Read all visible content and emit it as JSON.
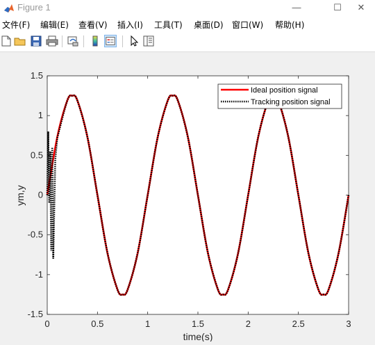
{
  "window": {
    "title": "Figure 1",
    "minimize_symbol": "—",
    "maximize_symbol": "☐",
    "close_symbol": "✕"
  },
  "menu": {
    "items": [
      {
        "label": "文件(F)"
      },
      {
        "label": "编辑(E)"
      },
      {
        "label": "查看(V)"
      },
      {
        "label": "插入(I)"
      },
      {
        "label": "工具(T)"
      },
      {
        "label": "桌面(D)"
      },
      {
        "label": "窗口(W)"
      },
      {
        "label": "帮助(H)"
      }
    ]
  },
  "toolbar": {
    "icons": [
      "new-figure-icon",
      "open-file-icon",
      "save-icon",
      "print-icon",
      "link-plot-icon",
      "insert-colorbar-icon",
      "insert-legend-icon",
      "edit-plot-pointer-icon",
      "property-inspector-icon"
    ]
  },
  "colors": {
    "ideal": "#ff0000",
    "tracking": "#000000",
    "accent": "#cfe4f7"
  },
  "chart_data": {
    "type": "line",
    "title": "",
    "xlabel": "time(s)",
    "ylabel": "ym,y",
    "xlim": [
      0,
      3
    ],
    "ylim": [
      -1.5,
      1.5
    ],
    "xticks": [
      0,
      0.5,
      1,
      1.5,
      2,
      2.5,
      3
    ],
    "xtick_labels": [
      "0",
      "0.5",
      "1",
      "1.5",
      "2",
      "2.5",
      "3"
    ],
    "yticks": [
      -1.5,
      -1,
      -0.5,
      0,
      0.5,
      1,
      1.5
    ],
    "ytick_labels": [
      "-1.5",
      "-1",
      "-0.5",
      "0",
      "0.5",
      "1",
      "1.5"
    ],
    "grid": false,
    "legend_position": "top-right",
    "series": [
      {
        "name": "Ideal position signal",
        "style": "solid",
        "x": [
          0,
          0.1,
          0.2,
          0.25,
          0.3,
          0.4,
          0.5,
          0.6,
          0.7,
          0.75,
          0.8,
          0.9,
          1.0,
          1.1,
          1.2,
          1.25,
          1.3,
          1.4,
          1.5,
          1.6,
          1.7,
          1.75,
          1.8,
          1.9,
          2.0,
          2.1,
          2.2,
          2.25,
          2.3,
          2.4,
          2.5,
          2.6,
          2.7,
          2.75,
          2.8,
          2.9,
          3.0
        ],
        "y": [
          0,
          0.73,
          1.19,
          1.25,
          1.19,
          0.73,
          0,
          -0.73,
          -1.19,
          -1.25,
          -1.19,
          -0.73,
          0,
          0.73,
          1.19,
          1.25,
          1.19,
          0.73,
          0,
          -0.73,
          -1.19,
          -1.25,
          -1.19,
          -0.73,
          0,
          0.73,
          1.19,
          1.25,
          1.19,
          0.73,
          0,
          -0.73,
          -1.19,
          -1.25,
          -1.19,
          -0.73,
          0
        ]
      },
      {
        "name": "Tracking position signal",
        "style": "dotted",
        "x": [
          0,
          0.01,
          0.02,
          0.03,
          0.04,
          0.05,
          0.06,
          0.08,
          0.1,
          0.2,
          0.25,
          0.3,
          0.4,
          0.5,
          0.6,
          0.7,
          0.75,
          0.8,
          0.9,
          1.0,
          1.1,
          1.2,
          1.25,
          1.3,
          1.4,
          1.5,
          1.6,
          1.7,
          1.75,
          1.8,
          1.9,
          2.0,
          2.1,
          2.2,
          2.25,
          2.3,
          2.4,
          2.5,
          2.6,
          2.7,
          2.75,
          2.8,
          2.9,
          3.0
        ],
        "y": [
          0,
          0.8,
          -0.1,
          0.55,
          -0.7,
          0.6,
          -0.8,
          0.45,
          0.72,
          1.19,
          1.25,
          1.19,
          0.73,
          0,
          -0.73,
          -1.19,
          -1.25,
          -1.19,
          -0.73,
          0,
          0.73,
          1.19,
          1.25,
          1.19,
          0.73,
          0,
          -0.73,
          -1.19,
          -1.25,
          -1.19,
          -0.73,
          0,
          0.73,
          1.19,
          1.25,
          1.19,
          0.73,
          0,
          -0.73,
          -1.19,
          -1.25,
          -1.19,
          -0.73,
          0
        ]
      }
    ]
  }
}
